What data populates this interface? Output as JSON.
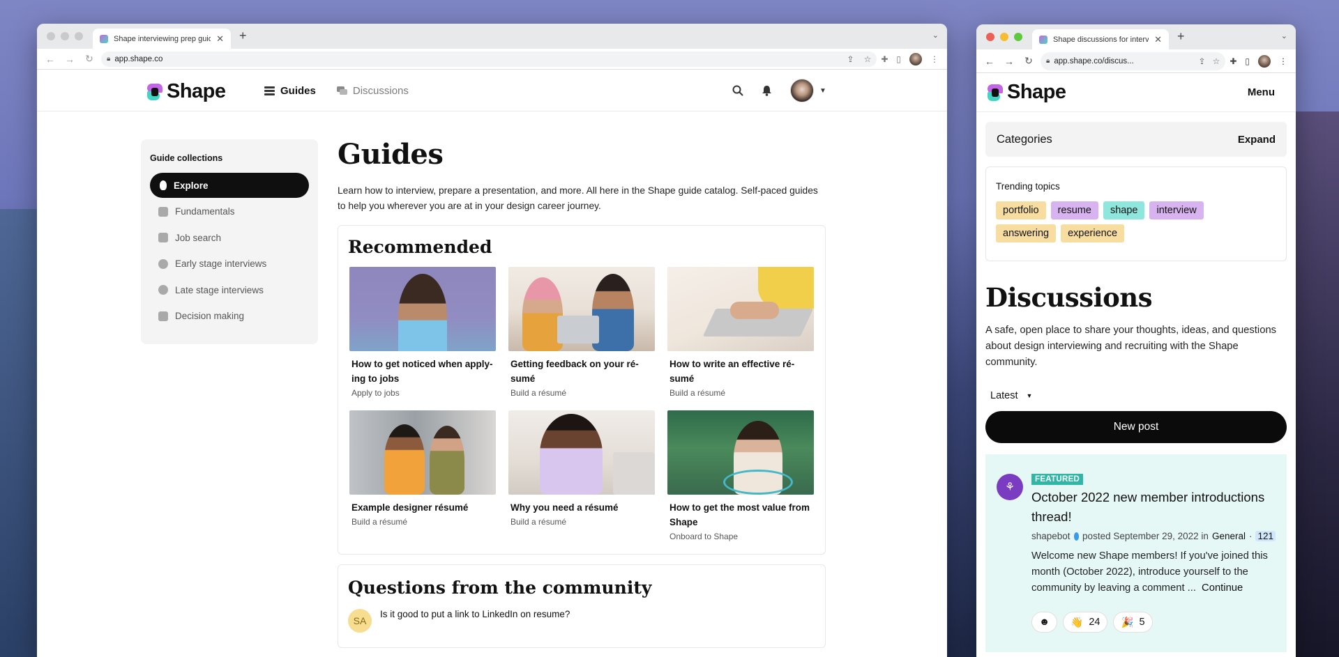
{
  "left_window": {
    "tab_title": "Shape interviewing prep guide",
    "url": "app.shape.co",
    "brand": "Shape",
    "nav": [
      {
        "label": "Guides",
        "active": true
      },
      {
        "label": "Discussions",
        "active": false
      }
    ],
    "sidebar": {
      "heading": "Guide collections",
      "items": [
        {
          "label": "Explore",
          "active": true,
          "icon": "lightbulb-icon"
        },
        {
          "label": "Fundamentals",
          "icon": "blocks-icon"
        },
        {
          "label": "Job search",
          "icon": "briefcase-icon"
        },
        {
          "label": "Early stage interviews",
          "icon": "chat-bubbles-icon"
        },
        {
          "label": "Late stage interviews",
          "icon": "star-badge-icon"
        },
        {
          "label": "Decision making",
          "icon": "stack-icon"
        }
      ]
    },
    "page_title": "Guides",
    "lead": "Learn how to interview, prepare a presentation, and more. All here in the Shape guide catalog. Self-paced guides to help you wherever you are at in your design career journey.",
    "recommended": {
      "heading": "Recommended",
      "guides": [
        {
          "title": "How to get noticed when apply-ing to jobs",
          "category": "Apply to jobs"
        },
        {
          "title": "Getting feedback on your ré-sumé",
          "category": "Build a résumé"
        },
        {
          "title": "How to write an effective ré-sumé",
          "category": "Build a résumé"
        },
        {
          "title": "Example designer résumé",
          "category": "Build a résumé"
        },
        {
          "title": "Why you need a résumé",
          "category": "Build a résumé"
        },
        {
          "title": "How to get the most value from Shape",
          "category": "Onboard to Shape"
        }
      ]
    },
    "community": {
      "heading": "Questions from the community",
      "first_question": {
        "avatar_initials": "SA",
        "text": "Is it good to put a link to LinkedIn on resume?"
      }
    }
  },
  "right_window": {
    "tab_title": "Shape discussions for interviews",
    "url": "app.shape.co/discus...",
    "brand": "Shape",
    "menu_label": "Menu",
    "categories": {
      "label": "Categories",
      "action": "Expand"
    },
    "trending": {
      "heading": "Trending topics",
      "tags": [
        {
          "label": "portfolio",
          "color": "#f8dda0"
        },
        {
          "label": "resume",
          "color": "#d7b3ef"
        },
        {
          "label": "shape",
          "color": "#8ee6dd"
        },
        {
          "label": "interview",
          "color": "#d7b3ef"
        },
        {
          "label": "answering",
          "color": "#f8dda0"
        },
        {
          "label": "experience",
          "color": "#f8dda0"
        }
      ]
    },
    "page_title": "Discussions",
    "lead": "A safe, open place to share your thoughts, ideas, and questions about design interviewing and recruiting with the Shape community.",
    "sort_label": "Latest",
    "new_post_label": "New post",
    "featured_post": {
      "badge": "FEATURED",
      "title": "October 2022 new member introductions thread!",
      "author": "shapebot",
      "posted_text": "posted September 29, 2022 in",
      "category": "General",
      "separator": "·",
      "count": "121",
      "excerpt": "Welcome new Shape members! If you've joined this month (October 2022), introduce yourself to the community by leaving a comment ...",
      "continue_label": "Continue",
      "reactions": [
        {
          "emoji": "☻",
          "count": ""
        },
        {
          "emoji": "👋",
          "count": "24"
        },
        {
          "emoji": "🎉",
          "count": "5"
        }
      ]
    }
  }
}
